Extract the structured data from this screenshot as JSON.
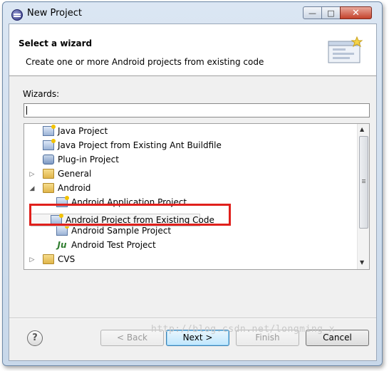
{
  "window": {
    "title": "New Project"
  },
  "banner": {
    "title": "Select a wizard",
    "description": "Create one or more Android projects from existing code"
  },
  "wizards": {
    "label": "Wizards:",
    "filter_value": "",
    "tree": [
      {
        "label": "Java Project",
        "icon": "java-project-icon",
        "level": 1
      },
      {
        "label": "Java Project from Existing Ant Buildfile",
        "icon": "java-project-icon",
        "level": 1
      },
      {
        "label": "Plug-in Project",
        "icon": "plugin-project-icon",
        "level": 1
      },
      {
        "label": "General",
        "icon": "folder-icon",
        "level": 0,
        "expander": "collapsed"
      },
      {
        "label": "Android",
        "icon": "folder-icon",
        "level": 0,
        "expander": "expanded"
      },
      {
        "label": "Android Application Project",
        "icon": "android-project-icon",
        "level": 1
      },
      {
        "label": "Android Project from Existing Code",
        "icon": "android-project-icon",
        "level": 1,
        "selected": true
      },
      {
        "label": "Android Sample Project",
        "icon": "android-project-icon",
        "level": 1
      },
      {
        "label": "Android Test Project",
        "icon": "junit-icon",
        "level": 1
      },
      {
        "label": "CVS",
        "icon": "folder-icon",
        "level": 0,
        "expander": "collapsed"
      }
    ]
  },
  "buttons": {
    "back": "< Back",
    "next": "Next >",
    "finish": "Finish",
    "cancel": "Cancel",
    "help": "?"
  },
  "watermark": "http://blog.csdn.net/longming_x",
  "colors": {
    "highlight": "#e0201c",
    "default_button": "#bee6fd"
  }
}
